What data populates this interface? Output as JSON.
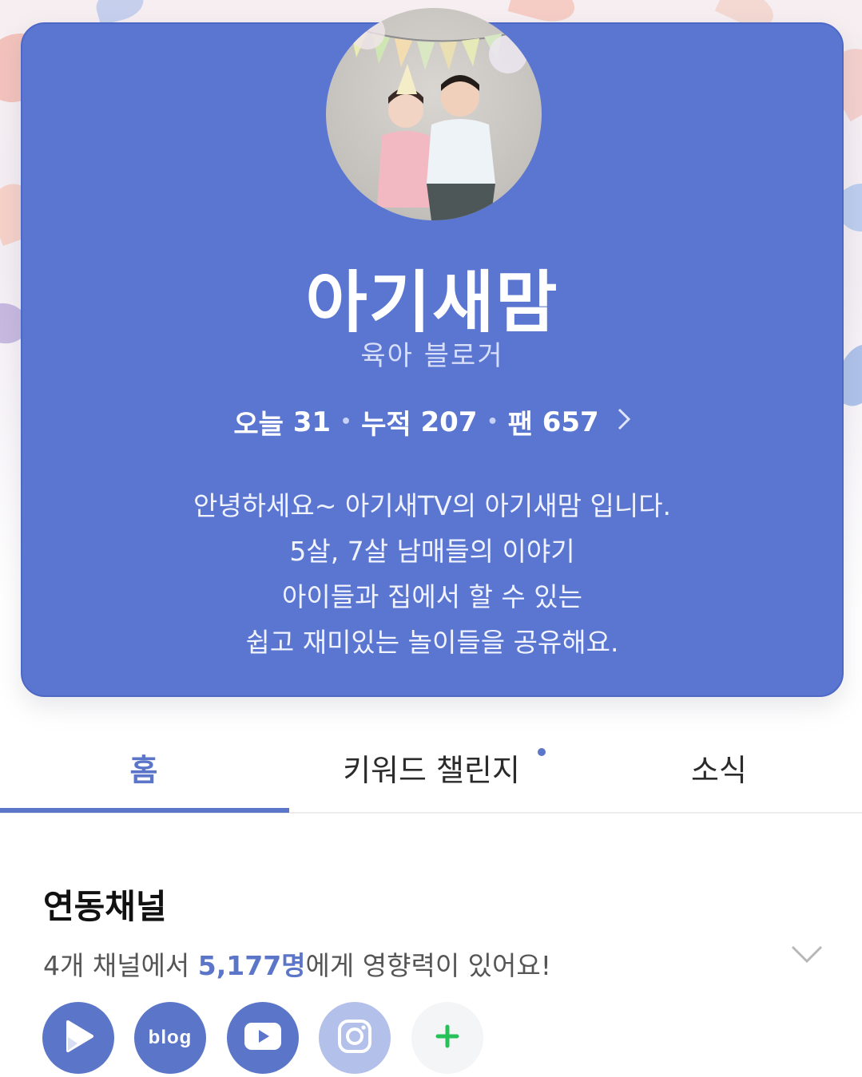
{
  "profile": {
    "name": "아기새맘",
    "role": "육아 블로거",
    "stats": {
      "today_label": "오늘",
      "today_value": "31",
      "total_label": "누적",
      "total_value": "207",
      "fans_label": "팬",
      "fans_value": "657"
    },
    "intro_lines": [
      "안녕하세요~ 아기새TV의 아기새맘 입니다.",
      "5살, 7살 남매들의 이야기",
      "아이들과 집에서 할 수 있는",
      "쉽고 재미있는 놀이들을 공유해요."
    ]
  },
  "tabs": [
    {
      "label": "홈",
      "active": true
    },
    {
      "label": "키워드 챌린지",
      "active": false
    },
    {
      "label": "소식",
      "active": false
    }
  ],
  "linked_channels": {
    "title": "연동채널",
    "desc_prefix": "4개 채널에서 ",
    "desc_highlight": "5,177명",
    "desc_suffix": "에게 영향력이 있어요!",
    "channels": [
      {
        "icon": "play-icon"
      },
      {
        "icon": "blog-icon",
        "label": "blog"
      },
      {
        "icon": "youtube-icon"
      },
      {
        "icon": "instagram-icon"
      },
      {
        "icon": "plus-icon"
      }
    ]
  },
  "colors": {
    "accent": "#5b76c8",
    "card": "#5b76d1",
    "plus": "#27c15a"
  }
}
